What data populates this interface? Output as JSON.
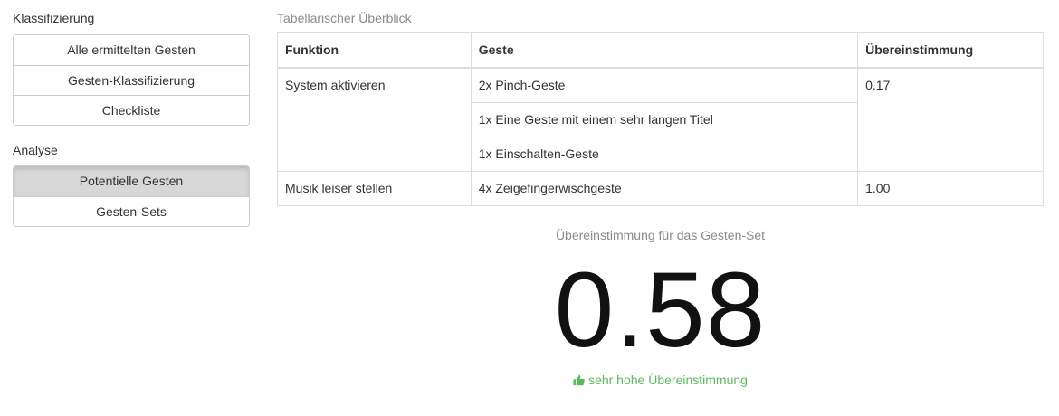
{
  "sidebar": {
    "section1_title": "Klassifizierung",
    "section1_items": [
      {
        "label": "Alle ermittelten Gesten"
      },
      {
        "label": "Gesten-Klassifizierung"
      },
      {
        "label": "Checkliste"
      }
    ],
    "section2_title": "Analyse",
    "section2_items": [
      {
        "label": "Potentielle Gesten",
        "active": true
      },
      {
        "label": "Gesten-Sets"
      }
    ]
  },
  "overview": {
    "caption": "Tabellarischer Überblick",
    "headers": [
      "Funktion",
      "Geste",
      "Übereinstimmung"
    ],
    "rows": [
      {
        "function": "System aktivieren",
        "gestures": [
          "2x Pinch-Geste",
          "1x Eine Geste mit einem sehr langen Titel",
          "1x Einschalten-Geste"
        ],
        "agreement": "0.17"
      },
      {
        "function": "Musik leiser stellen",
        "gestures": [
          "4x Zeigefingerwischgeste"
        ],
        "agreement": "1.00"
      }
    ]
  },
  "summary": {
    "label": "Übereinstimmung für das Gesten-Set",
    "score": "0.58",
    "rating_text": "sehr hohe Übereinstimmung",
    "rating_icon": "thumbs-up-icon",
    "rating_color": "#5cb85c"
  }
}
